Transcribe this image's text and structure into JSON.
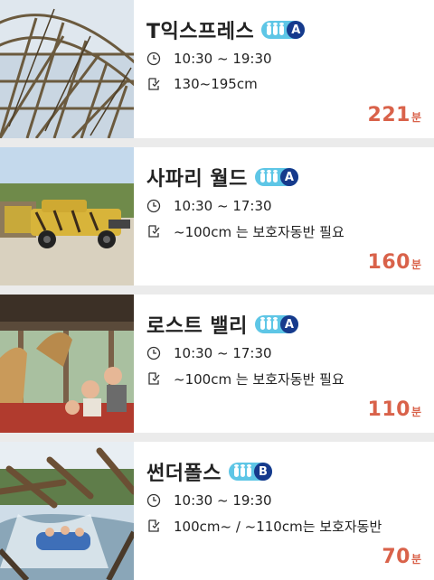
{
  "rides": [
    {
      "name": "T익스프레스",
      "grade": "A",
      "hours": "10:30 ~ 19:30",
      "height": "130~195cm",
      "wait_value": "221",
      "wait_unit": "분",
      "image": "wooden-roller-coaster"
    },
    {
      "name": "사파리 월드",
      "grade": "A",
      "hours": "10:30 ~ 17:30",
      "height": "~100cm 는 보호자동반 필요",
      "wait_value": "160",
      "wait_unit": "분",
      "image": "safari-truck"
    },
    {
      "name": "로스트 밸리",
      "grade": "A",
      "hours": "10:30 ~ 17:30",
      "height": "~100cm 는 보호자동반 필요",
      "wait_value": "110",
      "wait_unit": "분",
      "image": "amphibious-vehicle-giraffe"
    },
    {
      "name": "썬더폴스",
      "grade": "B",
      "hours": "10:30 ~ 19:30",
      "height": "100cm~ / ~110cm는 보호자동반",
      "wait_value": "70",
      "wait_unit": "분",
      "image": "water-boat-ride"
    }
  ],
  "icons": {
    "time": "clock-icon",
    "height": "height-check-icon"
  },
  "colors": {
    "wait_text": "#d9624a",
    "badge_bg": "#5ec6e6",
    "grade_bg": "#163a8c",
    "page_bg": "#ebebeb"
  }
}
